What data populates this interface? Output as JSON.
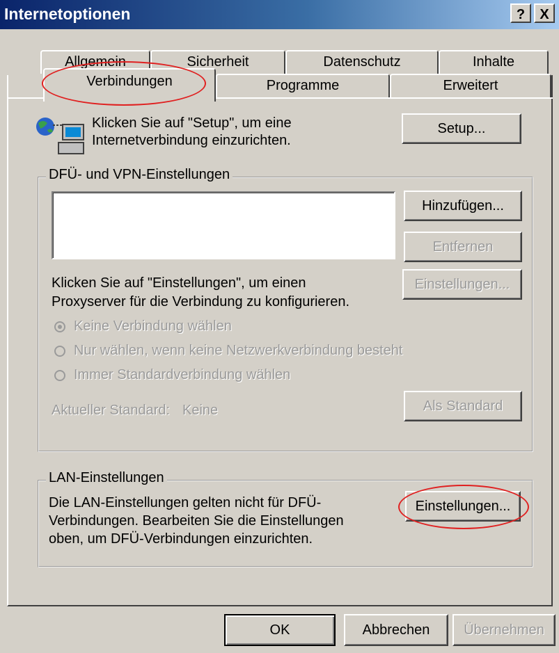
{
  "window": {
    "title": "Internetoptionen",
    "help_label": "?",
    "close_label": "X"
  },
  "tabs": {
    "row1": [
      "Allgemein",
      "Sicherheit",
      "Datenschutz",
      "Inhalte"
    ],
    "row2": [
      "Verbindungen",
      "Programme",
      "Erweitert"
    ],
    "active": "Verbindungen"
  },
  "setup": {
    "text_line1": "Klicken Sie auf \"Setup\", um eine",
    "text_line2": "Internetverbindung einzurichten.",
    "button": "Setup..."
  },
  "dialup": {
    "legend": "DFÜ- und VPN-Einstellungen",
    "add_button": "Hinzufügen...",
    "remove_button": "Entfernen",
    "settings_button": "Einstellungen...",
    "proxy_text_line1": "Klicken Sie auf \"Einstellungen\", um einen",
    "proxy_text_line2": "Proxyserver für die Verbindung zu konfigurieren.",
    "radio_options": [
      {
        "label": "Keine Verbindung wählen",
        "selected": true
      },
      {
        "label": "Nur wählen, wenn keine Netzwerkverbindung besteht",
        "selected": false
      },
      {
        "label": "Immer Standardverbindung wählen",
        "selected": false
      }
    ],
    "current_default_label": "Aktueller Standard:",
    "current_default_value": "Keine",
    "set_default_button": "Als Standard"
  },
  "lan": {
    "legend": "LAN-Einstellungen",
    "text_line1": "Die LAN-Einstellungen gelten nicht für DFÜ-",
    "text_line2": "Verbindungen. Bearbeiten Sie die Einstellungen",
    "text_line3": "oben, um DFÜ-Verbindungen einzurichten.",
    "settings_button": "Einstellungen..."
  },
  "footer": {
    "ok_button": "OK",
    "cancel_button": "Abbrechen",
    "apply_button": "Übernehmen"
  },
  "colors": {
    "face": "#d4d0c8",
    "titlebar_start": "#0a246a",
    "titlebar_end": "#a6caf0",
    "annotation": "#e02020",
    "disabled_text": "#9a9a9a"
  }
}
